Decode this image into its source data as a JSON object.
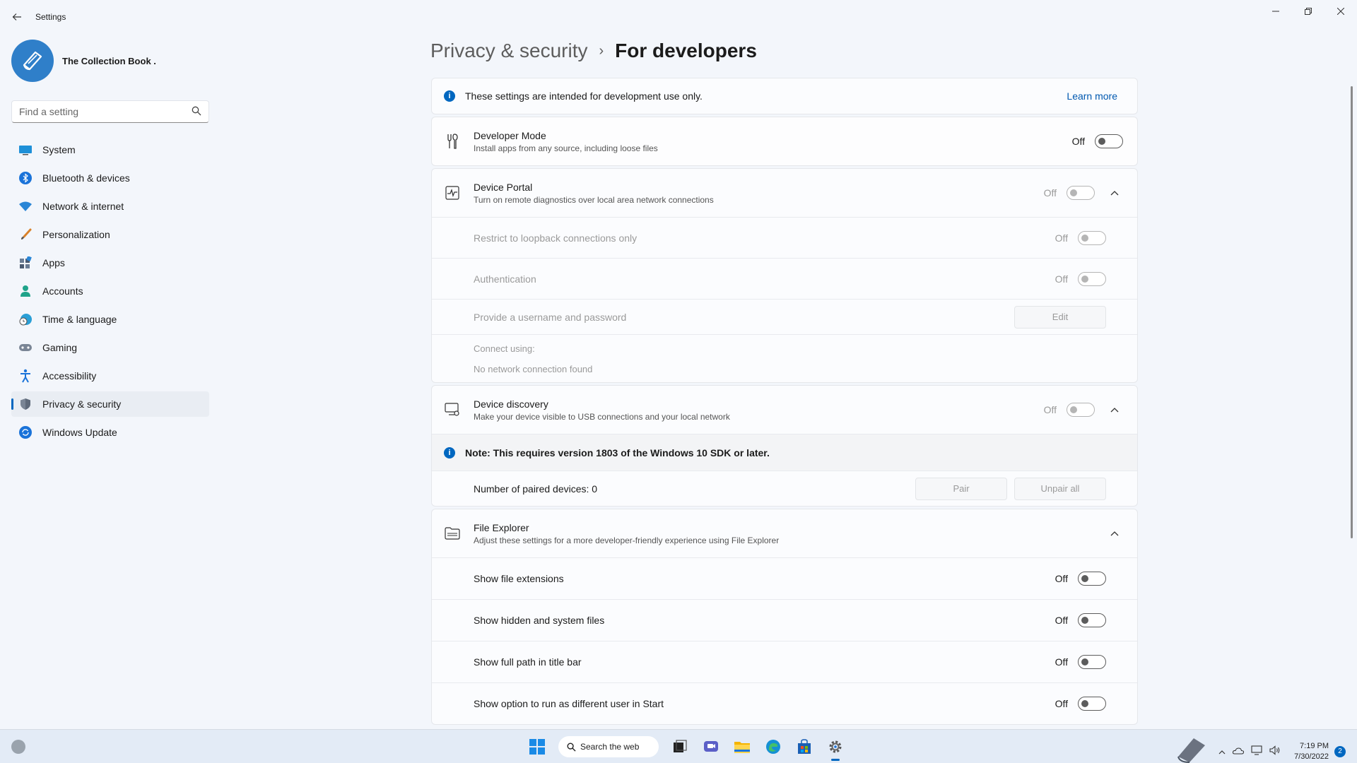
{
  "window": {
    "title": "Settings"
  },
  "profile": {
    "name": "The Collection Book ."
  },
  "search": {
    "placeholder": "Find a setting"
  },
  "nav": {
    "items": [
      {
        "label": "System"
      },
      {
        "label": "Bluetooth & devices"
      },
      {
        "label": "Network & internet"
      },
      {
        "label": "Personalization"
      },
      {
        "label": "Apps"
      },
      {
        "label": "Accounts"
      },
      {
        "label": "Time & language"
      },
      {
        "label": "Gaming"
      },
      {
        "label": "Accessibility"
      },
      {
        "label": "Privacy & security"
      },
      {
        "label": "Windows Update"
      }
    ]
  },
  "breadcrumb": {
    "parent": "Privacy & security",
    "separator": "›",
    "current": "For developers"
  },
  "info_banner": {
    "text": "These settings are intended for development use only.",
    "link": "Learn more"
  },
  "developer_mode": {
    "title": "Developer Mode",
    "subtitle": "Install apps from any source, including loose files",
    "state": "Off"
  },
  "device_portal": {
    "title": "Device Portal",
    "subtitle": "Turn on remote diagnostics over local area network connections",
    "state": "Off",
    "loopback": {
      "title": "Restrict to loopback connections only",
      "state": "Off"
    },
    "authentication": {
      "title": "Authentication",
      "state": "Off"
    },
    "credentials": {
      "title": "Provide a username and password",
      "button": "Edit"
    },
    "connect": {
      "label": "Connect using:",
      "value": "No network connection found"
    }
  },
  "device_discovery": {
    "title": "Device discovery",
    "subtitle": "Make your device visible to USB connections and your local network",
    "state": "Off",
    "note": "Note: This requires version 1803 of the Windows 10 SDK or later.",
    "paired": {
      "label": "Number of paired devices: 0",
      "pair_button": "Pair",
      "unpair_button": "Unpair all"
    }
  },
  "file_explorer": {
    "title": "File Explorer",
    "subtitle": "Adjust these settings for a more developer-friendly experience using File Explorer",
    "options": [
      {
        "title": "Show file extensions",
        "state": "Off"
      },
      {
        "title": "Show hidden and system files",
        "state": "Off"
      },
      {
        "title": "Show full path in title bar",
        "state": "Off"
      },
      {
        "title": "Show option to run as different user in Start",
        "state": "Off"
      }
    ]
  },
  "taskbar": {
    "search_label": "Search the web",
    "time": "7:19 PM",
    "date": "7/30/2022",
    "notification_count": "2"
  },
  "colors": {
    "accent": "#0067c0",
    "background": "#f3f6fb"
  }
}
